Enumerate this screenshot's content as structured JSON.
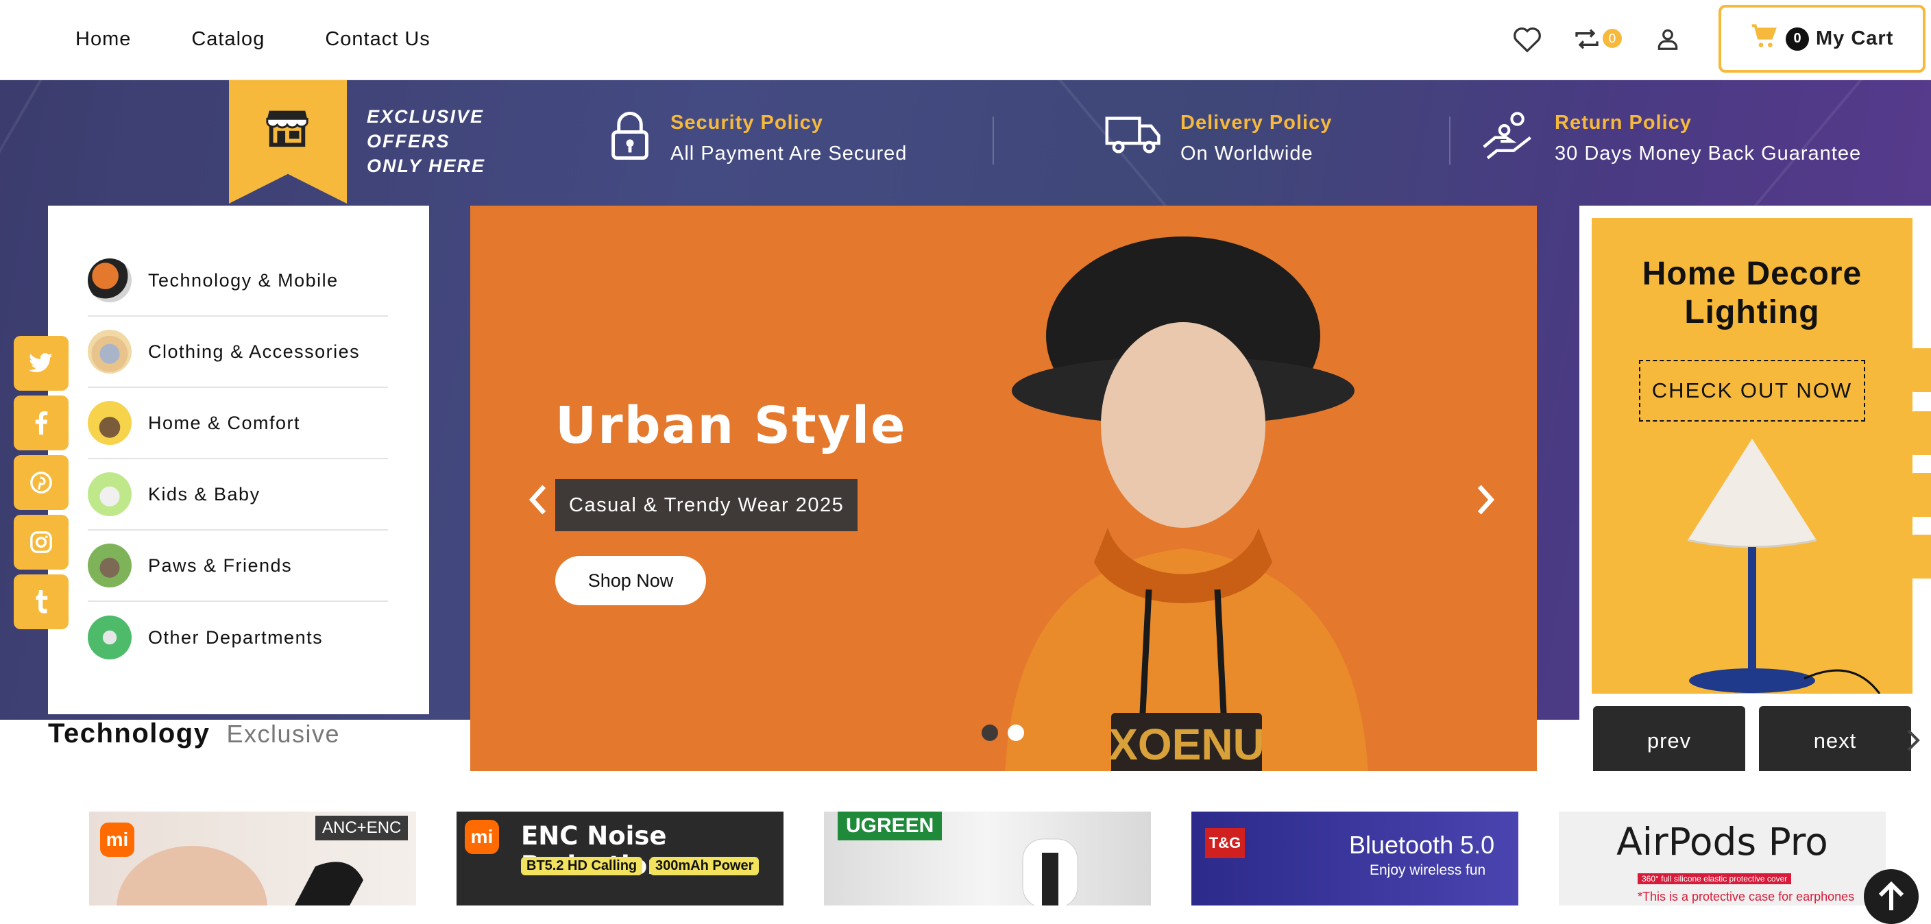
{
  "nav": {
    "links": [
      "Home",
      "Catalog",
      "Contact Us"
    ],
    "compare_count": "0",
    "cart_count": "0",
    "cart_label": "My Cart"
  },
  "banner": {
    "exclusive_text": "EXCLUSIVE OFFERS ONLY HERE",
    "policies": [
      {
        "title": "Security Policy",
        "subtitle": "All Payment Are Secured",
        "icon": "padlock-icon"
      },
      {
        "title": "Delivery Policy",
        "subtitle": "On Worldwide",
        "icon": "truck-icon"
      },
      {
        "title": "Return Policy",
        "subtitle": "30 Days Money Back Guarantee",
        "icon": "hand-coin-icon"
      }
    ]
  },
  "categories": [
    {
      "label": "Technology & Mobile"
    },
    {
      "label": "Clothing & Accessories"
    },
    {
      "label": "Home & Comfort"
    },
    {
      "label": "Kids & Baby"
    },
    {
      "label": "Paws & Friends"
    },
    {
      "label": "Other Departments"
    }
  ],
  "social": [
    "twitter-icon",
    "facebook-icon",
    "pinterest-icon",
    "instagram-icon",
    "tumblr-icon"
  ],
  "slider": {
    "title": "Urban Style",
    "subtitle": "Casual & Trendy Wear 2025",
    "button": "Shop Now",
    "active_slide": 2,
    "slide_count": 2
  },
  "promo": {
    "title_line1": "Home Decore",
    "title_line2": "Lighting",
    "button": "CHECK OUT NOW",
    "prev": "prev",
    "next": "next"
  },
  "tech_section": {
    "title": "Technology",
    "subtitle": "Exclusive",
    "products": [
      {
        "badge": "ANC+ENC",
        "brand": "mi",
        "headline": ""
      },
      {
        "badge": "",
        "brand": "mi",
        "headline": "ENC Noise Reduction",
        "tags": [
          "BT5.2 HD Calling",
          "300mAh Power"
        ]
      },
      {
        "badge": "",
        "brand": "UGREEN",
        "headline": ""
      },
      {
        "badge": "",
        "brand": "T&G",
        "headline": "Bluetooth 5.0",
        "sub": "Enjoy wireless fun"
      },
      {
        "badge": "",
        "brand": "",
        "headline": "AirPods Pro",
        "sub": "360° full silicone elastic protective cover",
        "note": "*This is a protective case for earphones"
      }
    ]
  },
  "colors": {
    "accent": "#f6b93b",
    "slide_bg": "#e4782d",
    "dark": "#2a2a2a"
  }
}
